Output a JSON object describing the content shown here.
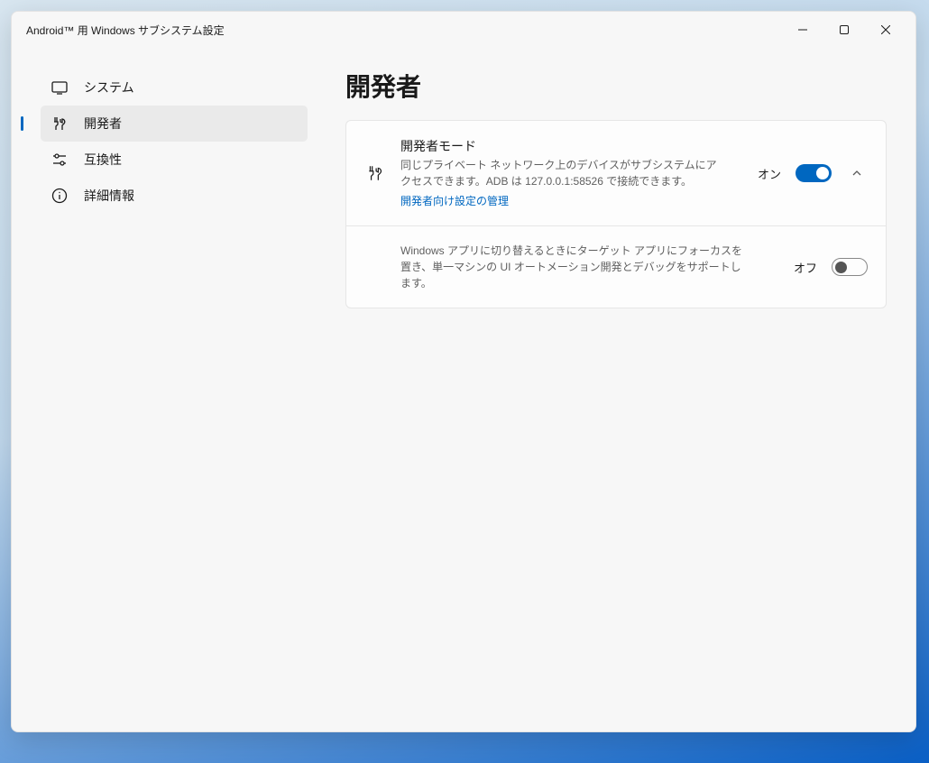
{
  "window": {
    "title": "Android™ 用 Windows サブシステム設定"
  },
  "sidebar": {
    "items": [
      {
        "label": "システム"
      },
      {
        "label": "開発者"
      },
      {
        "label": "互換性"
      },
      {
        "label": "詳細情報"
      }
    ]
  },
  "page": {
    "title": "開発者"
  },
  "settings": {
    "dev_mode": {
      "title": "開発者モード",
      "description": "同じプライベート ネットワーク上のデバイスがサブシステムにアクセスできます。ADB は 127.0.0.1:58526 で接続できます。",
      "link_label": "開発者向け設定の管理",
      "state_label": "オン",
      "toggle_on": true
    },
    "ui_automation": {
      "description": "Windows アプリに切り替えるときにターゲット アプリにフォーカスを置き、単一マシンの UI オートメーション開発とデバッグをサポートします。",
      "state_label": "オフ",
      "toggle_on": false
    }
  }
}
